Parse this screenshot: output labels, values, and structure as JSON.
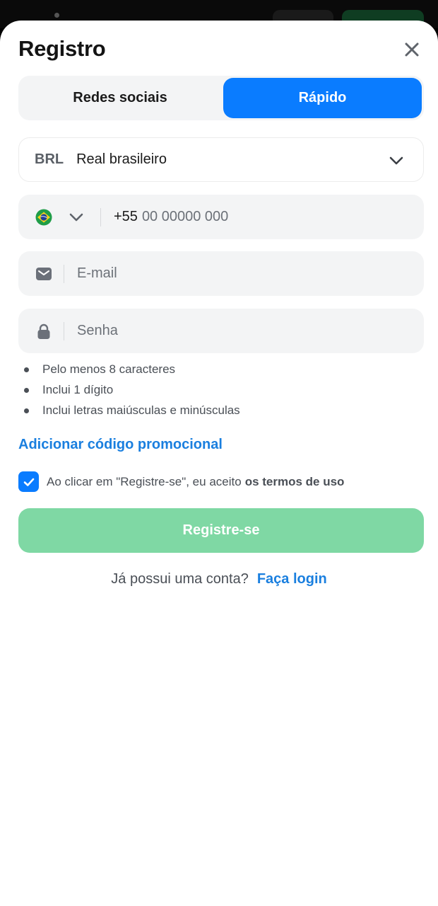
{
  "colors": {
    "accent": "#0a7cff",
    "link": "#1a7fdf",
    "submit_disabled": "#7fd8a4",
    "field_bg": "#f3f4f5"
  },
  "header": {
    "title": "Registro",
    "close_icon": "close-icon"
  },
  "tabs": [
    {
      "label": "Redes sociais",
      "active": false
    },
    {
      "label": "Rápido",
      "active": true
    }
  ],
  "currency": {
    "code": "BRL",
    "name": "Real brasileiro",
    "icon": "chevron-down-icon"
  },
  "phone": {
    "country_flag": "brazil-flag-icon",
    "prefix": "+55",
    "placeholder": "00 00000 000"
  },
  "email": {
    "icon": "envelope-icon",
    "placeholder": "E-mail"
  },
  "password": {
    "icon": "lock-icon",
    "placeholder": "Senha",
    "rules": [
      "Pelo menos 8 caracteres",
      "Inclui 1 dígito",
      "Inclui letras maiúsculas e minúsculas"
    ]
  },
  "promo_link": "Adicionar código promocional",
  "terms": {
    "checked": true,
    "text": "Ao clicar em \"Registre-se\", eu aceito",
    "link": "os termos de uso"
  },
  "submit_label": "Registre-se",
  "login": {
    "question": "Já possui uma conta?",
    "link": "Faça login"
  }
}
